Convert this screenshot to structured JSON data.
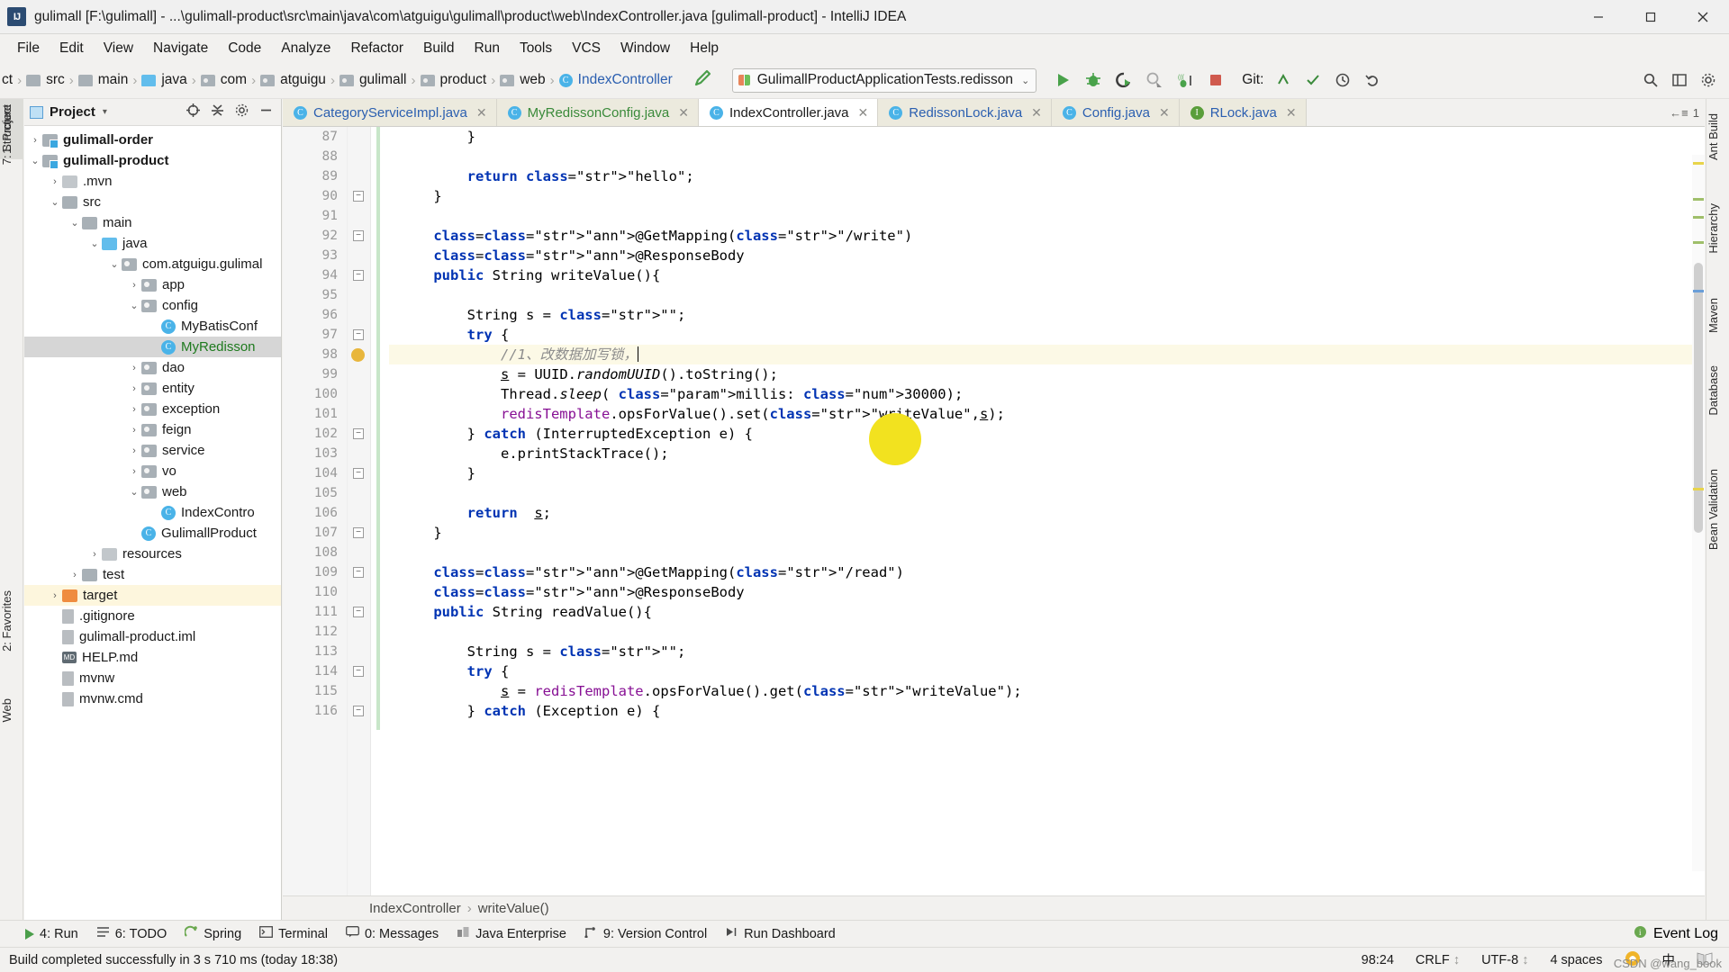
{
  "window": {
    "title": "gulimall [F:\\gulimall] - ...\\gulimall-product\\src\\main\\java\\com\\atguigu\\gulimall\\product\\web\\IndexController.java [gulimall-product] - IntelliJ IDEA",
    "app_icon": "IJ",
    "minimize": "—",
    "maximize": "❐",
    "close": "✕"
  },
  "menubar": {
    "items": [
      "File",
      "Edit",
      "View",
      "Navigate",
      "Code",
      "Analyze",
      "Refactor",
      "Build",
      "Run",
      "Tools",
      "VCS",
      "Window",
      "Help"
    ]
  },
  "navbar": {
    "crumbs": [
      {
        "label": "ct",
        "icon": "none"
      },
      {
        "label": "src",
        "icon": "folder"
      },
      {
        "label": "main",
        "icon": "folder"
      },
      {
        "label": "java",
        "icon": "folder-blue"
      },
      {
        "label": "com",
        "icon": "package"
      },
      {
        "label": "atguigu",
        "icon": "package"
      },
      {
        "label": "gulimall",
        "icon": "package"
      },
      {
        "label": "product",
        "icon": "package"
      },
      {
        "label": "web",
        "icon": "package"
      },
      {
        "label": "IndexController",
        "icon": "class"
      }
    ],
    "separator": "›",
    "build_icon": "hammer-icon",
    "run_config": "GulimallProductApplicationTests.redisson",
    "run_config_arrow": "⌄",
    "actions": [
      "run-icon",
      "debug-icon",
      "run-with-coverage-icon",
      "profiler-icon",
      "stop-icon"
    ],
    "git_label": "Git:",
    "git_actions": [
      "update-project-icon",
      "commit-icon",
      "history-icon",
      "rollback-icon"
    ],
    "right_actions": [
      "search-everywhere-icon",
      "settings-icon",
      "layout-icon"
    ]
  },
  "left_strip": {
    "tabs": [
      {
        "label": "1: Project",
        "active": true
      },
      {
        "label": "7: Structure",
        "active": false
      },
      {
        "label": "2: Favorites",
        "active": false
      },
      {
        "label": "Web",
        "active": false
      }
    ]
  },
  "right_strip": {
    "tabs": [
      "Ant Build",
      "Hierarchy",
      "Maven",
      "Database",
      "Bean Validation"
    ]
  },
  "project_panel": {
    "title": "Project",
    "caret": "▾",
    "head_icons": [
      "target-icon",
      "collapse-all-icon",
      "settings-icon",
      "hide-icon"
    ],
    "tree": [
      {
        "indent": 0,
        "arrow": "›",
        "icon": "module",
        "label": "gulimall-order",
        "bold": true,
        "state": "normal"
      },
      {
        "indent": 0,
        "arrow": "⌄",
        "icon": "module",
        "label": "gulimall-product",
        "bold": true,
        "state": "normal"
      },
      {
        "indent": 1,
        "arrow": "›",
        "icon": "folder-light",
        "label": ".mvn",
        "bold": false,
        "state": "normal"
      },
      {
        "indent": 1,
        "arrow": "⌄",
        "icon": "folder",
        "label": "src",
        "bold": false,
        "state": "normal"
      },
      {
        "indent": 2,
        "arrow": "⌄",
        "icon": "folder",
        "label": "main",
        "bold": false,
        "state": "normal"
      },
      {
        "indent": 3,
        "arrow": "⌄",
        "icon": "folder-blue",
        "label": "java",
        "bold": false,
        "state": "normal"
      },
      {
        "indent": 4,
        "arrow": "⌄",
        "icon": "package",
        "label": "com.atguigu.gulimal",
        "bold": false,
        "state": "normal"
      },
      {
        "indent": 5,
        "arrow": "›",
        "icon": "package",
        "label": "app",
        "bold": false,
        "state": "normal"
      },
      {
        "indent": 5,
        "arrow": "⌄",
        "icon": "package",
        "label": "config",
        "bold": false,
        "state": "normal"
      },
      {
        "indent": 6,
        "arrow": "",
        "icon": "class",
        "label": "MyBatisConf",
        "bold": false,
        "state": "normal"
      },
      {
        "indent": 6,
        "arrow": "",
        "icon": "class",
        "label": "MyRedisson",
        "bold": false,
        "state": "selected"
      },
      {
        "indent": 5,
        "arrow": "›",
        "icon": "package",
        "label": "dao",
        "bold": false,
        "state": "normal"
      },
      {
        "indent": 5,
        "arrow": "›",
        "icon": "package",
        "label": "entity",
        "bold": false,
        "state": "normal"
      },
      {
        "indent": 5,
        "arrow": "›",
        "icon": "package",
        "label": "exception",
        "bold": false,
        "state": "normal"
      },
      {
        "indent": 5,
        "arrow": "›",
        "icon": "package",
        "label": "feign",
        "bold": false,
        "state": "normal"
      },
      {
        "indent": 5,
        "arrow": "›",
        "icon": "package",
        "label": "service",
        "bold": false,
        "state": "normal"
      },
      {
        "indent": 5,
        "arrow": "›",
        "icon": "package",
        "label": "vo",
        "bold": false,
        "state": "normal"
      },
      {
        "indent": 5,
        "arrow": "⌄",
        "icon": "package",
        "label": "web",
        "bold": false,
        "state": "normal"
      },
      {
        "indent": 6,
        "arrow": "",
        "icon": "class",
        "label": "IndexContro",
        "bold": false,
        "state": "normal"
      },
      {
        "indent": 5,
        "arrow": "",
        "icon": "class-run",
        "label": "GulimallProduct",
        "bold": false,
        "state": "normal"
      },
      {
        "indent": 3,
        "arrow": "›",
        "icon": "folder-light",
        "label": "resources",
        "bold": false,
        "state": "normal"
      },
      {
        "indent": 2,
        "arrow": "›",
        "icon": "folder",
        "label": "test",
        "bold": false,
        "state": "normal"
      },
      {
        "indent": 1,
        "arrow": "›",
        "icon": "folder-orange",
        "label": "target",
        "bold": false,
        "state": "highlight"
      },
      {
        "indent": 1,
        "arrow": "",
        "icon": "file",
        "label": ".gitignore",
        "bold": false,
        "state": "normal"
      },
      {
        "indent": 1,
        "arrow": "",
        "icon": "file",
        "label": "gulimall-product.iml",
        "bold": false,
        "state": "normal"
      },
      {
        "indent": 1,
        "arrow": "",
        "icon": "md",
        "label": "HELP.md",
        "bold": false,
        "state": "normal"
      },
      {
        "indent": 1,
        "arrow": "",
        "icon": "file",
        "label": "mvnw",
        "bold": false,
        "state": "normal"
      },
      {
        "indent": 1,
        "arrow": "",
        "icon": "file",
        "label": "mvnw.cmd",
        "bold": false,
        "state": "normal"
      }
    ]
  },
  "editor": {
    "tabs": [
      {
        "label": "CategoryServiceImpl.java",
        "icon": "C",
        "color": "blue",
        "active": false
      },
      {
        "label": "MyRedissonConfig.java",
        "icon": "C",
        "color": "green",
        "active": false
      },
      {
        "label": "IndexController.java",
        "icon": "C",
        "color": "blue",
        "active": true
      },
      {
        "label": "RedissonLock.java",
        "icon": "C",
        "color": "blue",
        "active": false
      },
      {
        "label": "Config.java",
        "icon": "C",
        "color": "blue",
        "active": false
      },
      {
        "label": "RLock.java",
        "icon": "I",
        "color": "blue",
        "active": false
      }
    ],
    "tab_close": "✕",
    "first_line_number": 87,
    "lines": [
      {
        "n": 87,
        "text": "        }",
        "hl": false,
        "fold": false
      },
      {
        "n": 88,
        "text": "",
        "hl": false,
        "fold": false
      },
      {
        "n": 89,
        "text": "        return \"hello\";",
        "hl": false,
        "fold": false
      },
      {
        "n": 90,
        "text": "    }",
        "hl": false,
        "fold": true
      },
      {
        "n": 91,
        "text": "",
        "hl": false,
        "fold": false
      },
      {
        "n": 92,
        "text": "    @GetMapping(\"/write\")",
        "hl": false,
        "fold": true
      },
      {
        "n": 93,
        "text": "    @ResponseBody",
        "hl": false,
        "fold": false
      },
      {
        "n": 94,
        "text": "    public String writeValue(){",
        "hl": false,
        "fold": true
      },
      {
        "n": 95,
        "text": "",
        "hl": false,
        "fold": false
      },
      {
        "n": 96,
        "text": "        String s = \"\";",
        "hl": false,
        "fold": false
      },
      {
        "n": 97,
        "text": "        try {",
        "hl": false,
        "fold": true
      },
      {
        "n": 98,
        "text": "            //1、改数据加写锁，",
        "hl": true,
        "fold": false
      },
      {
        "n": 99,
        "text": "            s = UUID.randomUUID().toString();",
        "hl": false,
        "fold": false
      },
      {
        "n": 100,
        "text": "            Thread.sleep( millis: 30000);",
        "hl": false,
        "fold": false
      },
      {
        "n": 101,
        "text": "            redisTemplate.opsForValue().set(\"writeValue\",s);",
        "hl": false,
        "fold": false
      },
      {
        "n": 102,
        "text": "        } catch (InterruptedException e) {",
        "hl": false,
        "fold": true
      },
      {
        "n": 103,
        "text": "            e.printStackTrace();",
        "hl": false,
        "fold": false
      },
      {
        "n": 104,
        "text": "        }",
        "hl": false,
        "fold": true
      },
      {
        "n": 105,
        "text": "",
        "hl": false,
        "fold": false
      },
      {
        "n": 106,
        "text": "        return  s;",
        "hl": false,
        "fold": false
      },
      {
        "n": 107,
        "text": "    }",
        "hl": false,
        "fold": true
      },
      {
        "n": 108,
        "text": "",
        "hl": false,
        "fold": false
      },
      {
        "n": 109,
        "text": "    @GetMapping(\"/read\")",
        "hl": false,
        "fold": true
      },
      {
        "n": 110,
        "text": "    @ResponseBody",
        "hl": false,
        "fold": false
      },
      {
        "n": 111,
        "text": "    public String readValue(){",
        "hl": false,
        "fold": true
      },
      {
        "n": 112,
        "text": "",
        "hl": false,
        "fold": false
      },
      {
        "n": 113,
        "text": "        String s = \"\";",
        "hl": false,
        "fold": false
      },
      {
        "n": 114,
        "text": "        try {",
        "hl": false,
        "fold": true
      },
      {
        "n": 115,
        "text": "            s = redisTemplate.opsForValue().get(\"writeValue\");",
        "hl": false,
        "fold": false
      },
      {
        "n": 116,
        "text": "        } catch (Exception e) {",
        "hl": false,
        "fold": true
      }
    ],
    "breadcrumb": {
      "class": "IndexController",
      "sep": "›",
      "method": "writeValue()"
    }
  },
  "tool_window_bar": {
    "items": [
      {
        "icon": "run-icon",
        "label": "4: Run"
      },
      {
        "icon": "todo-icon",
        "label": "6: TODO"
      },
      {
        "icon": "spring-icon",
        "label": "Spring"
      },
      {
        "icon": "terminal-icon",
        "label": "Terminal"
      },
      {
        "icon": "messages-icon",
        "label": "0: Messages"
      },
      {
        "icon": "java-enterprise-icon",
        "label": "Java Enterprise"
      },
      {
        "icon": "version-control-icon",
        "label": "9: Version Control"
      },
      {
        "icon": "run-dashboard-icon",
        "label": "Run Dashboard"
      }
    ],
    "event_log": "Event Log"
  },
  "statusbar": {
    "message": "Build completed successfully in 3 s 710 ms (today 18:38)",
    "caret_position": "98:24",
    "line_separator": "CRLF",
    "line_separator_arrow": "↕",
    "encoding": "UTF-8",
    "encoding_arrow": "↕",
    "indent": "4 spaces",
    "ime_icons": [
      "ime-logo-icon",
      "ime-chinese-icon",
      "ime-book-icon"
    ],
    "ime_text_1": "中",
    "ime_text_2": "@wang_book"
  },
  "watermark": "CSDN @wang_book",
  "colors": {
    "accent_blue": "#2b5fb0",
    "keyword_blue": "#0033b3",
    "string_green": "#067d17",
    "annotation_gold": "#9e880d",
    "number_blue": "#1750eb",
    "field_purple": "#871094",
    "highlight_yellow": "#f2e21f",
    "chrome_gray": "#f2f1ef"
  }
}
